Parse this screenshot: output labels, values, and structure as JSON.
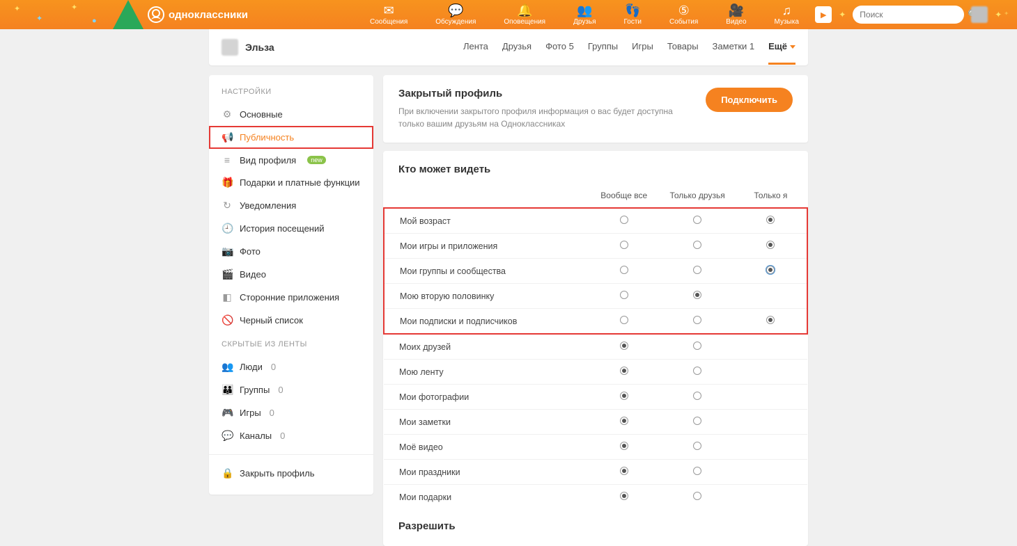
{
  "brand": "одноклассники",
  "topnav": [
    {
      "icon": "✉",
      "label": "Сообщения"
    },
    {
      "icon": "💬",
      "label": "Обсуждения"
    },
    {
      "icon": "🔔",
      "label": "Оповещения"
    },
    {
      "icon": "👥",
      "label": "Друзья"
    },
    {
      "icon": "👣",
      "label": "Гости"
    },
    {
      "icon": "⑤",
      "label": "События"
    },
    {
      "icon": "🎥",
      "label": "Видео"
    },
    {
      "icon": "♫",
      "label": "Музыка"
    }
  ],
  "search_placeholder": "Поиск",
  "profile_name": "Эльза",
  "tabs": [
    {
      "label": "Лента"
    },
    {
      "label": "Друзья"
    },
    {
      "label": "Фото 5"
    },
    {
      "label": "Группы"
    },
    {
      "label": "Игры"
    },
    {
      "label": "Товары"
    },
    {
      "label": "Заметки 1"
    },
    {
      "label": "Ещё",
      "more": true
    }
  ],
  "sidebar": {
    "title": "НАСТРОЙКИ",
    "items": [
      {
        "icon": "⚙",
        "label": "Основные"
      },
      {
        "icon": "📢",
        "label": "Публичность",
        "active": true,
        "highlight": true
      },
      {
        "icon": "≡",
        "label": "Вид профиля",
        "badge": "new"
      },
      {
        "icon": "🎁",
        "label": "Подарки и платные функции"
      },
      {
        "icon": "↻",
        "label": "Уведомления"
      },
      {
        "icon": "🕘",
        "label": "История посещений"
      },
      {
        "icon": "📷",
        "label": "Фото"
      },
      {
        "icon": "🎬",
        "label": "Видео"
      },
      {
        "icon": "◧",
        "label": "Сторонние приложения"
      },
      {
        "icon": "🚫",
        "label": "Черный список"
      }
    ],
    "hidden_title": "СКРЫТЫЕ ИЗ ЛЕНТЫ",
    "hidden": [
      {
        "icon": "👥",
        "label": "Люди",
        "count": "0"
      },
      {
        "icon": "👪",
        "label": "Группы",
        "count": "0"
      },
      {
        "icon": "🎮",
        "label": "Игры",
        "count": "0"
      },
      {
        "icon": "💬",
        "label": "Каналы",
        "count": "0"
      }
    ],
    "close_profile": {
      "icon": "🔒",
      "label": "Закрыть профиль"
    }
  },
  "closed_card": {
    "title": "Закрытый профиль",
    "desc": "При включении закрытого профиля информация о вас будет доступна только вашим друзьям на Одноклассниках",
    "btn": "Подключить"
  },
  "visibility": {
    "title": "Кто может видеть",
    "cols": [
      "Вообще все",
      "Только друзья",
      "Только я"
    ],
    "rows": [
      {
        "label": "Мой возраст",
        "sel": 2,
        "box": true
      },
      {
        "label": "Мои игры и приложения",
        "sel": 2,
        "box": true
      },
      {
        "label": "Мои группы и сообщества",
        "sel": 2,
        "box": true,
        "focused": true
      },
      {
        "label": "Мою вторую половинку",
        "sel": 1,
        "box": true,
        "two": true
      },
      {
        "label": "Мои подписки и подписчиков",
        "sel": 2,
        "box": true
      },
      {
        "label": "Моих друзей",
        "sel": 0,
        "two": true
      },
      {
        "label": "Мою ленту",
        "sel": 0,
        "two": true
      },
      {
        "label": "Мои фотографии",
        "sel": 0,
        "two": true
      },
      {
        "label": "Мои заметки",
        "sel": 0,
        "two": true
      },
      {
        "label": "Моё видео",
        "sel": 0,
        "two": true
      },
      {
        "label": "Мои праздники",
        "sel": 0,
        "two": true
      },
      {
        "label": "Мои подарки",
        "sel": 0,
        "two": true
      }
    ]
  },
  "allow_title": "Разрешить"
}
